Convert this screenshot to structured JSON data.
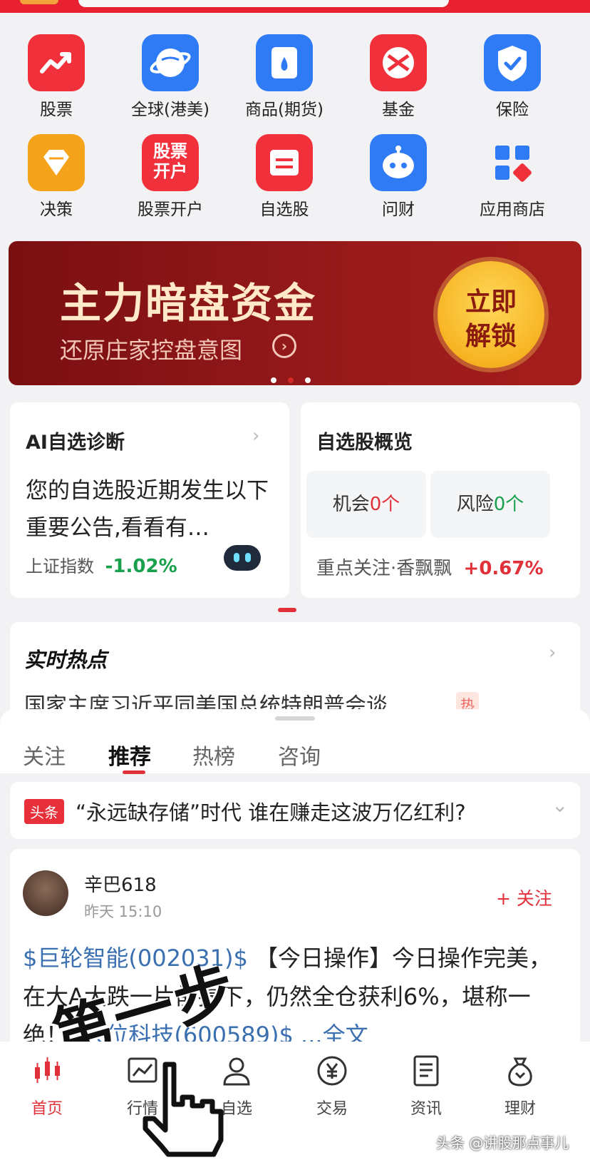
{
  "grid": [
    {
      "label": "股票",
      "icon": "stock-trend-icon",
      "color": "#f0313c"
    },
    {
      "label": "全球(港美)",
      "icon": "globe-icon",
      "color": "#2f7bf5"
    },
    {
      "label": "商品(期货)",
      "icon": "commodity-bag-icon",
      "color": "#2f7bf5"
    },
    {
      "label": "基金",
      "icon": "fund-icon",
      "color": "#f0313c"
    },
    {
      "label": "保险",
      "icon": "shield-check-icon",
      "color": "#2f7bf5"
    },
    {
      "label": "决策",
      "icon": "diamond-icon",
      "color": "#f6a31c"
    },
    {
      "label": "股票开户",
      "icon": "account-open-icon",
      "icon_text_1": "股票",
      "icon_text_2": "开户",
      "color": "#f0313c"
    },
    {
      "label": "自选股",
      "icon": "watchlist-icon",
      "color": "#f0313c"
    },
    {
      "label": "问财",
      "icon": "robot-icon",
      "color": "#2f7bf5"
    },
    {
      "label": "应用商店",
      "icon": "app-store-icon",
      "color": "#2f7bf5"
    }
  ],
  "banner": {
    "title": "主力暗盘资金",
    "subtitle": "还原庄家控盘意图",
    "button_line1": "立即",
    "button_line2": "解锁"
  },
  "ai_card": {
    "title": "AI自选诊断",
    "body": "您的自选股近期发生以下重要公告,看看有…",
    "index_label": "上证指数",
    "index_change": "-1.02%"
  },
  "overview_card": {
    "title": "自选股概览",
    "opportunity_label": "机会",
    "opportunity_count": "0个",
    "risk_label": "风险",
    "risk_count": "0个",
    "focus_label": "重点关注·香飘飘",
    "focus_change": "+0.67%"
  },
  "hot": {
    "title": "实时热点",
    "headline": "国家主席习近平同美国总统特朗普会谈",
    "tag": "热"
  },
  "tabs": [
    "关注",
    "推荐",
    "热榜",
    "咨询"
  ],
  "active_tab": "推荐",
  "headline": {
    "tag": "头条",
    "title": "“永远缺存储”时代 谁在赚走这波万亿红利?"
  },
  "post": {
    "user": "辛巴618",
    "time": "昨天 15:10",
    "follow": "+ 关注",
    "stock_link_1": "$巨轮智能(002031)$",
    "text_1": " 【今日操作】今日操作完美，在大A大跌一片前提下，仍然全仓获利6%，堪称一绝！",
    "stock_link_2": "$大位科技(600589)$",
    "text_2": " ...全文"
  },
  "overlay_text": "第一步",
  "nav": [
    {
      "label": "首页",
      "icon": "candlestick-icon",
      "active": true
    },
    {
      "label": "行情",
      "icon": "market-chart-icon",
      "active": false
    },
    {
      "label": "自选",
      "icon": "user-watch-icon",
      "active": false
    },
    {
      "label": "交易",
      "icon": "yuan-coin-icon",
      "active": false
    },
    {
      "label": "资讯",
      "icon": "news-doc-icon",
      "active": false
    },
    {
      "label": "理财",
      "icon": "money-bag-icon",
      "active": false
    }
  ],
  "watermark": "头条 @讲股那点事儿"
}
